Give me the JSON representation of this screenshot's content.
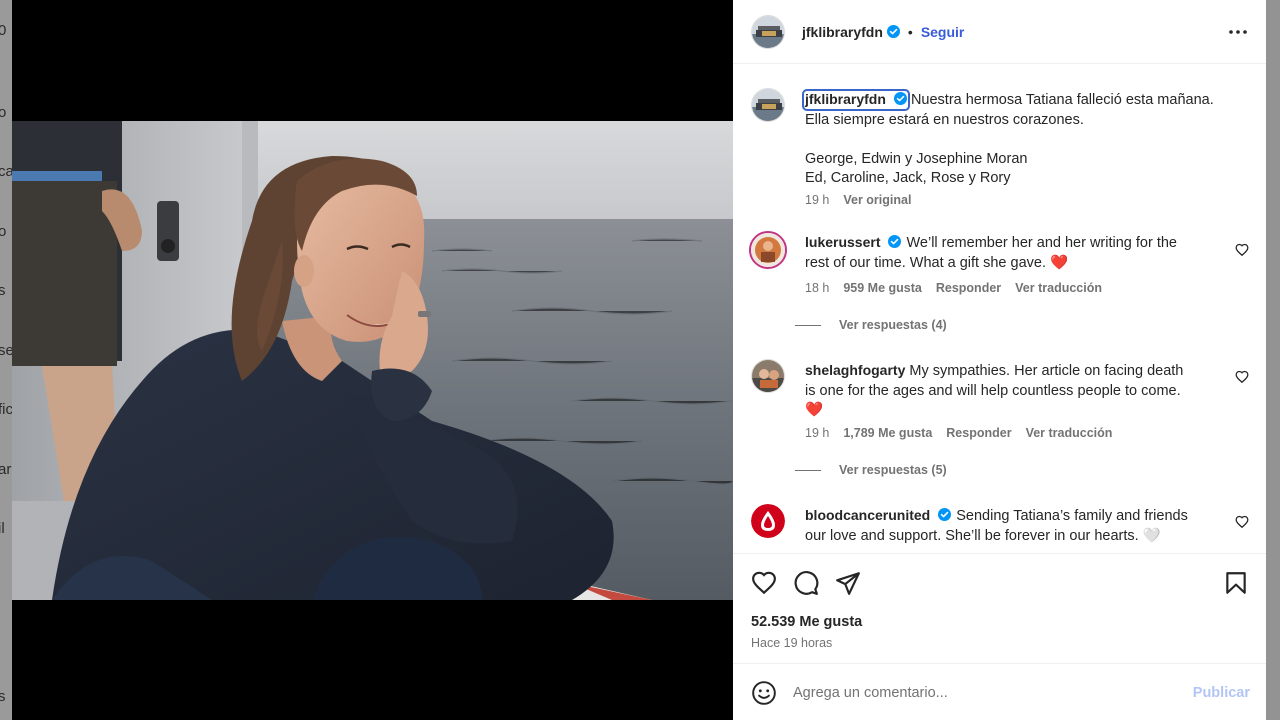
{
  "background": {
    "letters": [
      "0",
      "o",
      "ca",
      "o",
      "s",
      "se",
      "fic",
      "ar",
      "il",
      "s"
    ]
  },
  "header": {
    "username": "jfklibraryfdn",
    "dot": "•",
    "follow_label": "Seguir",
    "more_icon": "more-horizontal-icon"
  },
  "caption": {
    "username": "jfklibraryfdn",
    "line1": "Nuestra hermosa Tatiana falleció esta mañana.",
    "line2": "Ella siempre estará en nuestros corazones.",
    "line3": "George, Edwin y Josephine Moran",
    "line4": "Ed, Caroline, Jack, Rose y Rory",
    "time": "19 h",
    "see_original": "Ver original"
  },
  "comments": [
    {
      "username": "lukerussert",
      "verified": true,
      "text_line1": "We’ll remember her and her writing for the",
      "text_line2": "rest of our time. What a gift she gave. ❤️",
      "time": "18 h",
      "likes": "959 Me gusta",
      "reply_label": "Responder",
      "translate_label": "Ver traducción",
      "replies_label": "Ver respuestas (4)"
    },
    {
      "username": "shelaghfogarty",
      "verified": false,
      "text_line1": "My sympathies. Her article on facing death",
      "text_line2": "is one for the ages and will help countless people to come.",
      "text_line3": "❤️",
      "time": "19 h",
      "likes": "1,789 Me gusta",
      "reply_label": "Responder",
      "translate_label": "Ver traducción",
      "replies_label": "Ver respuestas (5)"
    },
    {
      "username": "bloodcancerunited",
      "verified": true,
      "text_line1": "Sending Tatiana’s family and friends",
      "text_line2": "our love and support. She’ll be forever in our hearts. 🤍"
    }
  ],
  "actions": {
    "like_icon": "heart-icon",
    "comment_icon": "comment-bubble-icon",
    "share_icon": "paper-plane-icon",
    "save_icon": "bookmark-icon",
    "likes_count": "52.539 Me gusta",
    "time_ago": "Hace 19 horas"
  },
  "add_comment": {
    "emoji_icon": "smiley-icon",
    "placeholder": "Agrega un comentario...",
    "post_label": "Publicar"
  },
  "colors": {
    "link_blue": "#3a5bd9",
    "verified_blue": "#0095f6",
    "muted_text": "#737373",
    "post_button_disabled": "#b3c5f5"
  }
}
